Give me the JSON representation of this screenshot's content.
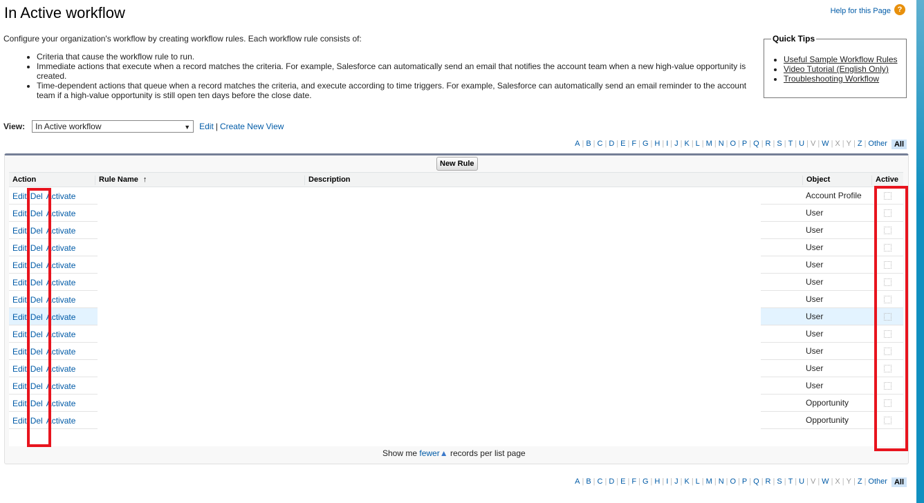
{
  "header": {
    "title": "In Active workflow",
    "help": "Help for this Page",
    "help_icon": "?"
  },
  "intro": {
    "text": "Configure your organization's workflow by creating workflow rules. Each workflow rule consists of:",
    "bullets": [
      "Criteria that cause the workflow rule to run.",
      "Immediate actions that execute when a record matches the criteria. For example, Salesforce can automatically send an email that notifies the account team when a new high-value opportunity is created.",
      "Time-dependent actions that queue when a record matches the criteria, and execute according to time triggers. For example, Salesforce can automatically send an email reminder to the account team if a high-value opportunity is still open ten days before the close date."
    ]
  },
  "quick_tips": {
    "title": "Quick Tips",
    "links": [
      "Useful Sample Workflow Rules",
      "Video Tutorial (English Only)",
      "Troubleshooting Workflow"
    ]
  },
  "view": {
    "label": "View:",
    "selected": "In Active workflow",
    "edit": "Edit",
    "separator": "|",
    "create": "Create New View"
  },
  "alphabet": [
    "A",
    "B",
    "C",
    "D",
    "E",
    "F",
    "G",
    "H",
    "I",
    "J",
    "K",
    "L",
    "M",
    "N",
    "O",
    "P",
    "Q",
    "R",
    "S",
    "T",
    "U",
    "V",
    "W",
    "X",
    "Y",
    "Z",
    "Other"
  ],
  "alphabet_all": "All",
  "table": {
    "new_rule": "New Rule",
    "columns": {
      "action": "Action",
      "rule_name": "Rule Name",
      "sort_icon": "↑",
      "description": "Description",
      "object": "Object",
      "active": "Active"
    },
    "actions": {
      "edit": "Edit",
      "del": "Del",
      "activate": "Activate"
    },
    "rows": [
      {
        "object": "Account Profile"
      },
      {
        "object": "User"
      },
      {
        "object": "User"
      },
      {
        "object": "User"
      },
      {
        "object": "User"
      },
      {
        "object": "User"
      },
      {
        "object": "User"
      },
      {
        "object": "User",
        "highlighted": true
      },
      {
        "object": "User"
      },
      {
        "object": "User"
      },
      {
        "object": "User"
      },
      {
        "object": "User"
      },
      {
        "object": "Opportunity"
      },
      {
        "object": "Opportunity"
      }
    ]
  },
  "footer": {
    "prefix": "Show me",
    "link": "fewer",
    "suffix": "records per list page"
  }
}
